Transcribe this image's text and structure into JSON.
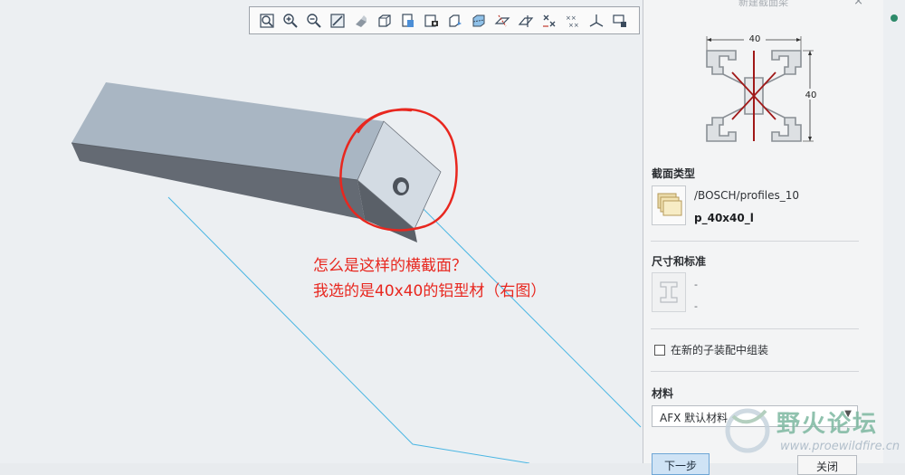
{
  "toolbar": {
    "buttons": [
      "zoom-fit",
      "zoom-in",
      "zoom-out",
      "repaint",
      "saved-orientations",
      "view-manager",
      "display-style",
      "appearance",
      "hidden-line",
      "section-view",
      "datum-planes",
      "datum-axes",
      "datum-points",
      "coordinate-systems",
      "annotation-display",
      "more"
    ]
  },
  "annotation": {
    "line1": "怎么是这样的横截面？",
    "line2": "我选的是40x40的铝型材（右图）",
    "color": "#e8271f"
  },
  "panel": {
    "title": "新建截面梁",
    "close_glyph": "×",
    "preview": {
      "width_label": "40",
      "height_label": "40"
    },
    "section_type_heading": "截面类型",
    "section_path": "/BOSCH/profiles_10",
    "section_name": "p_40x40_l",
    "dimensions_heading": "尺寸和标准",
    "dim_value_1": "-",
    "dim_value_2": "-",
    "assembly_checkbox_label": "在新的子装配中组装",
    "assembly_checked": false,
    "material_heading": "材料",
    "material_value": "AFX 默认材料",
    "next_button": "下一步",
    "close_button": "关闭"
  },
  "watermark": {
    "title": "野火论坛",
    "url": "www.proewildfire.cn"
  },
  "colors": {
    "viewport_bg": "#eceff2",
    "beam_top": "#a9b6c3",
    "beam_side": "#646a73",
    "beam_end": "#d3dbe3",
    "cable": "#4ab6e3",
    "profile_stroke": "#8a8f95",
    "profile_cross": "#a01818"
  }
}
